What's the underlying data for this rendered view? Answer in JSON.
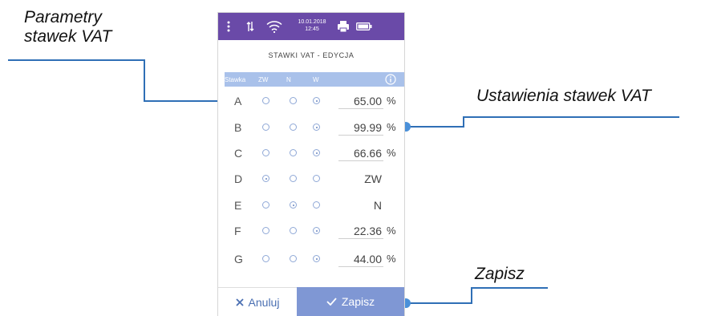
{
  "callouts": {
    "params": "Parametry\nstawek VAT",
    "settings": "Ustawienia stawek VAT",
    "save": "Zapisz"
  },
  "status": {
    "date": "10.01.2018",
    "time": "12:45"
  },
  "screen": {
    "title": "STAWKI VAT - EDYCJA",
    "headers": {
      "stawka": "Stawka",
      "zw": "ZW",
      "n": "N",
      "w": "W"
    }
  },
  "rows": [
    {
      "letter": "A",
      "selected": "W",
      "value": "65.00",
      "unit": "%"
    },
    {
      "letter": "B",
      "selected": "W",
      "value": "99.99",
      "unit": "%"
    },
    {
      "letter": "C",
      "selected": "W",
      "value": "66.66",
      "unit": "%"
    },
    {
      "letter": "D",
      "selected": "ZW",
      "value": "ZW",
      "unit": ""
    },
    {
      "letter": "E",
      "selected": "N",
      "value": "N",
      "unit": ""
    },
    {
      "letter": "F",
      "selected": "W",
      "value": "22.36",
      "unit": "%"
    },
    {
      "letter": "G",
      "selected": "W",
      "value": "44.00",
      "unit": "%"
    }
  ],
  "buttons": {
    "cancel": "Anuluj",
    "save": "Zapisz"
  },
  "colors": {
    "statusbar": "#6a4aa8",
    "header": "#a9c1ea",
    "save_button": "#7f97d4",
    "callout_line": "#2f6fb6"
  },
  "icons": [
    "menu-dots-icon",
    "transfer-icon",
    "wifi-icon",
    "printer-icon",
    "battery-icon",
    "info-icon",
    "close-icon",
    "check-icon"
  ]
}
